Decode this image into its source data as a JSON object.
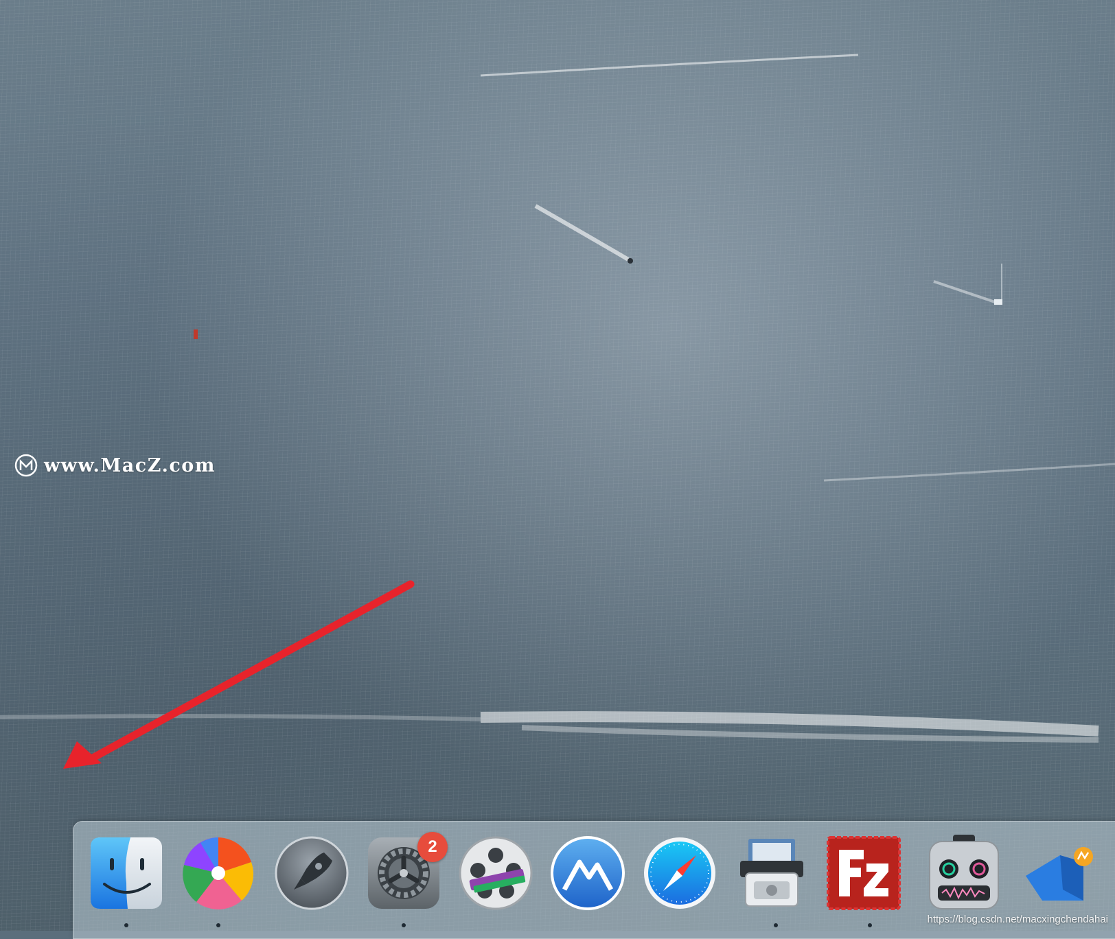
{
  "desktop": {
    "wallpaper": "ocean-aerial-wallpaper",
    "watermark_text": "www.MacZ.com",
    "credit_text": "https://blog.csdn.net/macxingchendahai"
  },
  "annotation": {
    "arrow_color": "#e8232b"
  },
  "dock": {
    "items": [
      {
        "name": "finder-icon",
        "running": true
      },
      {
        "name": "pinwheel-app-icon",
        "running": true
      },
      {
        "name": "launchpad-icon",
        "running": false
      },
      {
        "name": "system-preferences-icon",
        "running": true,
        "badge": "2"
      },
      {
        "name": "video-converter-icon",
        "running": false
      },
      {
        "name": "mountain-app-icon",
        "running": false
      },
      {
        "name": "safari-icon",
        "running": false
      },
      {
        "name": "disk-printer-icon",
        "running": true
      },
      {
        "name": "filezilla-icon",
        "running": true
      },
      {
        "name": "robot-audio-app-icon",
        "running": false
      },
      {
        "name": "blue-shape-app-icon",
        "running": false
      }
    ]
  }
}
